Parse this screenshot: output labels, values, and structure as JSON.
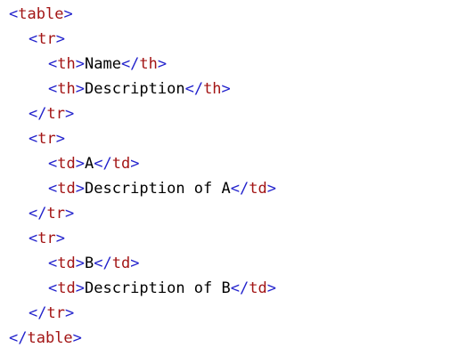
{
  "colors": {
    "bracket": "#2222cc",
    "tag_name": "#a31515",
    "text": "#000000",
    "background": "#ffffff"
  },
  "code": {
    "table_tag": "table",
    "tr_tag": "tr",
    "th_tag": "th",
    "td_tag": "td",
    "header_cells": [
      "Name",
      "Description"
    ],
    "rows": [
      {
        "cells": [
          "A",
          "Description of A"
        ]
      },
      {
        "cells": [
          "B",
          "Description of B"
        ]
      }
    ]
  }
}
